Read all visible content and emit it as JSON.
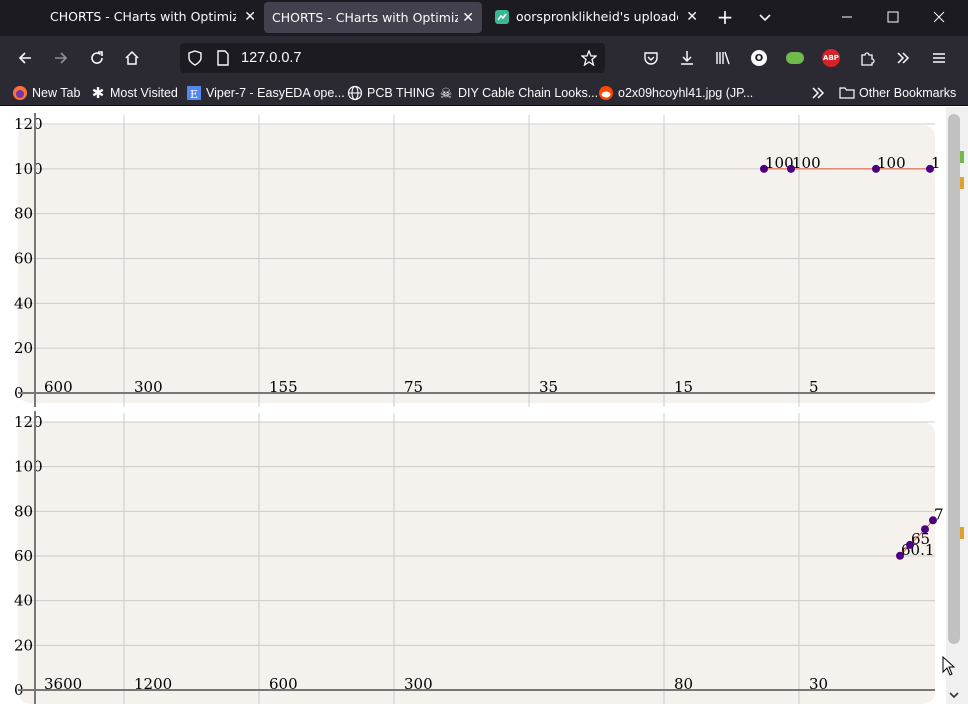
{
  "browser": {
    "tabs": [
      {
        "title": "CHORTS - CHarts with Optimized N",
        "active": false
      },
      {
        "title": "CHORTS - CHarts with Optimized N",
        "active": true
      },
      {
        "title": "oorspronklikheid's uploaded im",
        "active": false
      }
    ],
    "url": "127.0.0.7",
    "bookmarks": [
      {
        "label": "New Tab",
        "icon": "firefox-icon"
      },
      {
        "label": "Most Visited",
        "icon": "gear-icon"
      },
      {
        "label": "Viper-7 - EasyEDA ope...",
        "icon": "easyeda-icon"
      },
      {
        "label": "PCB THING",
        "icon": "globe-icon"
      },
      {
        "label": "DIY Cable Chain Looks...",
        "icon": "skull-icon"
      },
      {
        "label": "o2x09hcoyhl41.jpg (JP...",
        "icon": "reddit-icon"
      }
    ],
    "other_bookmarks": "Other Bookmarks",
    "extension_badge": "O",
    "abp_label": "ABP"
  },
  "colors": {
    "plot_bg": "#f5f1ed",
    "grid": "#cccccc",
    "axis": "#777777",
    "point": "#4b0082",
    "line": "#e0553a"
  },
  "chart_data": [
    {
      "type": "line",
      "ylim": [
        0,
        120
      ],
      "yticks": [
        "0",
        "20",
        "40",
        "60",
        "80",
        "100",
        "120"
      ],
      "xticks": [
        "600",
        "300",
        "155",
        "75",
        "35",
        "15",
        "5"
      ],
      "series": [
        {
          "points": [
            {
              "x": 1.5,
              "y": 100,
              "label": "100"
            },
            {
              "x": 1.3,
              "y": 100,
              "label": "100"
            },
            {
              "x": 0.7,
              "y": 100,
              "label": "100"
            },
            {
              "x": 0.3,
              "y": 100,
              "label": "1"
            }
          ]
        }
      ]
    },
    {
      "type": "line",
      "ylim": [
        0,
        120
      ],
      "yticks": [
        "0",
        "20",
        "40",
        "60",
        "80",
        "100",
        "120"
      ],
      "xticks": [
        "3600",
        "1200",
        "600",
        "300",
        "80",
        "30"
      ],
      "series": [
        {
          "points": [
            {
              "x": 8,
              "y": 60.1,
              "label": "60.1"
            },
            {
              "x": 7,
              "y": 65,
              "label": "65"
            },
            {
              "x": 6,
              "y": 72,
              "label": ""
            },
            {
              "x": 5,
              "y": 76,
              "label": "7"
            }
          ]
        }
      ]
    }
  ]
}
